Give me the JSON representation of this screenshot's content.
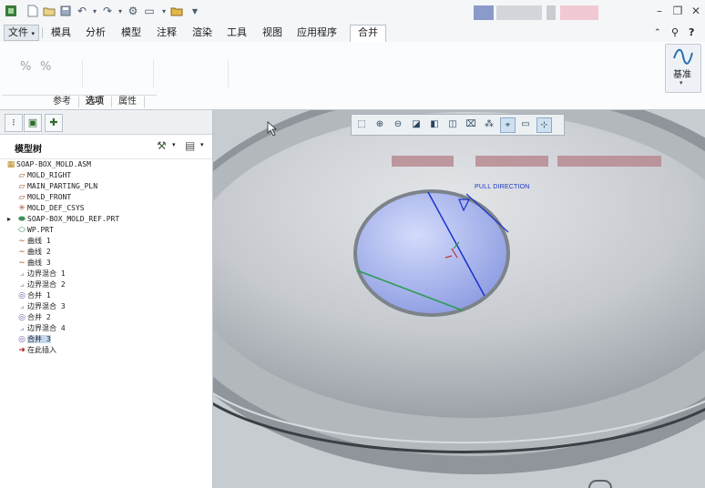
{
  "ribbon": {
    "tabs": [
      {
        "label": "文件",
        "kind": "file"
      },
      {
        "label": "模具"
      },
      {
        "label": "分析"
      },
      {
        "label": "模型"
      },
      {
        "label": "注释"
      },
      {
        "label": "渲染"
      },
      {
        "label": "工具"
      },
      {
        "label": "视图"
      },
      {
        "label": "应用程序"
      },
      {
        "label": "合并",
        "active": true
      }
    ],
    "subtabs": [
      "参考",
      "选项",
      "属性"
    ],
    "datum_label": "基准"
  },
  "model_tree": {
    "title": "模型树",
    "items": [
      {
        "label": "SOAP-BOX_MOLD.ASM",
        "icon": "assembly-icon",
        "level": 0
      },
      {
        "label": "MOLD_RIGHT",
        "icon": "datum-plane-icon",
        "level": 1
      },
      {
        "label": "MAIN_PARTING_PLN",
        "icon": "datum-plane-icon",
        "level": 1
      },
      {
        "label": "MOLD_FRONT",
        "icon": "datum-plane-icon",
        "level": 1
      },
      {
        "label": "MOLD_DEF_CSYS",
        "icon": "csys-icon",
        "level": 1
      },
      {
        "label": "SOAP-BOX_MOLD_REF.PRT",
        "icon": "part-icon",
        "level": 1,
        "expandable": true
      },
      {
        "label": "WP.PRT",
        "icon": "workpiece-icon",
        "level": 1
      },
      {
        "label": "曲线 1",
        "icon": "curve-icon",
        "level": 1
      },
      {
        "label": "曲线 2",
        "icon": "curve-icon",
        "level": 1
      },
      {
        "label": "曲线 3",
        "icon": "curve-icon",
        "level": 1
      },
      {
        "label": "边界混合 1",
        "icon": "boundary-blend-icon",
        "level": 1
      },
      {
        "label": "边界混合 2",
        "icon": "boundary-blend-icon",
        "level": 1
      },
      {
        "label": "合并 1",
        "icon": "merge-icon",
        "level": 1
      },
      {
        "label": "边界混合 3",
        "icon": "boundary-blend-icon",
        "level": 1
      },
      {
        "label": "合并 2",
        "icon": "merge-icon",
        "level": 1
      },
      {
        "label": "边界混合 4",
        "icon": "boundary-blend-icon",
        "level": 1
      },
      {
        "label": "合并 3",
        "icon": "merge-icon",
        "level": 1,
        "selected": true
      },
      {
        "label": "在此插入",
        "icon": "insert-here-arrow-icon",
        "level": 1
      }
    ]
  },
  "viewport": {
    "annotation": "PULL DIRECTION"
  },
  "colors": {
    "surface_gray": "#c9cdd1",
    "preview_blue": "#aab8ee",
    "pull_direction_blue": "#1a34c8",
    "edge_green": "#2c9b52",
    "selection": "#c6d8ee"
  }
}
